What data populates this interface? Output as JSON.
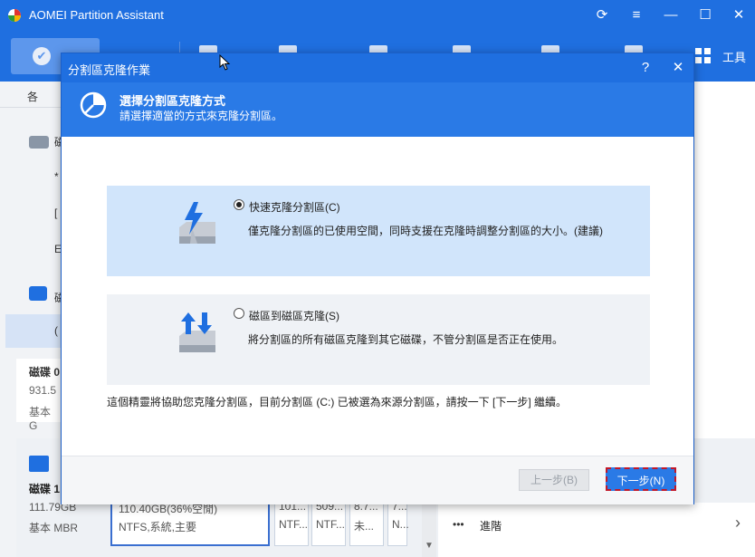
{
  "app": {
    "title": "AOMEI Partition Assistant",
    "controls": {
      "refresh": "⟳",
      "menu": "≡",
      "minimize": "—",
      "maximize": "☐",
      "close": "✕"
    }
  },
  "toolbar": {
    "tools_label": "工具"
  },
  "left_panel": {
    "items": [
      {
        "text": "各"
      },
      {
        "text": "磁"
      },
      {
        "text": "*"
      },
      {
        "text": "["
      },
      {
        "text": "E"
      },
      {
        "text": "磁"
      },
      {
        "text": "("
      }
    ],
    "card": {
      "title": "磁碟 0",
      "size": "931.5",
      "type": "基本 G"
    }
  },
  "disk1": {
    "title": "磁碟 1",
    "size": "111.79GB",
    "type": "基本 MBR",
    "partitions": [
      {
        "top": "110.40GB(36%空閒)",
        "bottom": "NTFS,系統,主要"
      },
      {
        "top": "101...",
        "bottom": "NTF..."
      },
      {
        "top": "509...",
        "bottom": "NTF..."
      },
      {
        "top": "8.7...",
        "bottom": "未..."
      },
      {
        "top": "7...",
        "bottom": "N..."
      }
    ]
  },
  "right_panel": {
    "more_icon": "•••",
    "advanced_label": "進階",
    "chevron": "›"
  },
  "dialog": {
    "title": "分割區克隆作業",
    "help": "?",
    "close": "✕",
    "heading": "選擇分割區克隆方式",
    "subheading": "請選擇適當的方式來克隆分割區。",
    "options": [
      {
        "label": "快速克隆分割區(C)",
        "description": "僅克隆分割區的已使用空間，同時支援在克隆時調整分割區的大小。(建議)",
        "selected": true
      },
      {
        "label": "磁區到磁區克隆(S)",
        "description": "將分割區的所有磁區克隆到其它磁碟，不管分割區是否正在使用。",
        "selected": false
      }
    ],
    "info": "這個精靈將協助您克隆分割區，目前分割區 (C:) 已被選為來源分割區，請按一下 [下一步] 繼續。",
    "back_label": "上一步(B)",
    "next_label": "下一步(N)"
  },
  "colors": {
    "accent": "#1f6fe0",
    "header": "#2a7ae6",
    "selected_option": "#d1e5fb",
    "focus_border": "#c0182a"
  }
}
